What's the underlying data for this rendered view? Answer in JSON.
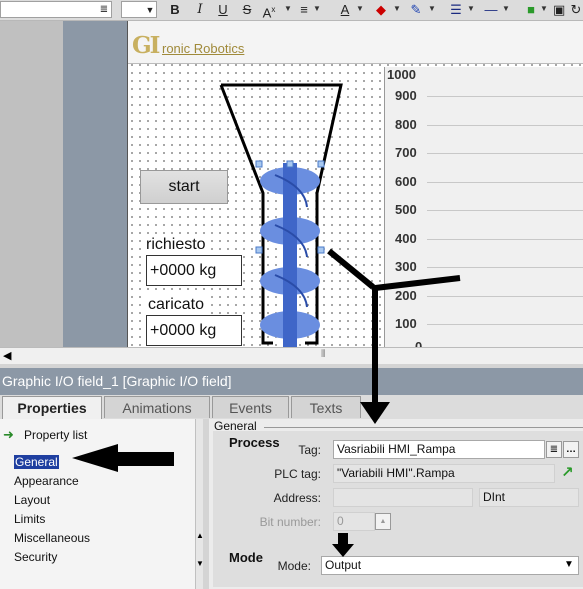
{
  "toolbar": {
    "font_style_buttons": [
      "B",
      "I",
      "U",
      "S",
      "A"
    ],
    "icons": [
      "bold-icon",
      "italic-icon",
      "underline-icon",
      "strikethrough-icon",
      "superscript-icon",
      "align-icon",
      "text-color-icon",
      "fill-color-icon",
      "line-color-icon",
      "line-style-icon",
      "line-width-icon",
      "foreground-icon",
      "background-icon",
      "rotate-icon"
    ]
  },
  "screen": {
    "logo_letter": "GI",
    "logo_text": "ronic Robotics",
    "start_button": "start",
    "requested_label": "richiesto",
    "requested_value": "+0000 kg",
    "loaded_label": "caricato",
    "loaded_value": "+0000 kg",
    "graph_ticks": [
      "1000",
      "900",
      "800",
      "700",
      "600",
      "500",
      "400",
      "300",
      "200",
      "100",
      "0"
    ]
  },
  "inspector": {
    "title": "Graphic I/O field_1 [Graphic I/O field]",
    "tabs": [
      "Properties",
      "Animations",
      "Events",
      "Texts"
    ],
    "active_tab": "Properties",
    "nav": {
      "property_list": "Property list",
      "items": [
        "General",
        "Appearance",
        "Layout",
        "Limits",
        "Miscellaneous",
        "Security"
      ],
      "selected": "General"
    },
    "general_heading": "General",
    "process": {
      "title": "Process",
      "tag_label": "Tag:",
      "tag_value": "Vasriabili HMI_Rampa",
      "plc_tag_label": "PLC tag:",
      "plc_tag_value": "\"Variabili HMI\".Rampa",
      "address_label": "Address:",
      "address_value": "",
      "datatype_value": "DInt",
      "bit_number_label": "Bit number:",
      "bit_number_value": "0"
    },
    "mode": {
      "title": "Mode",
      "mode_label": "Mode:",
      "mode_value": "Output"
    }
  }
}
